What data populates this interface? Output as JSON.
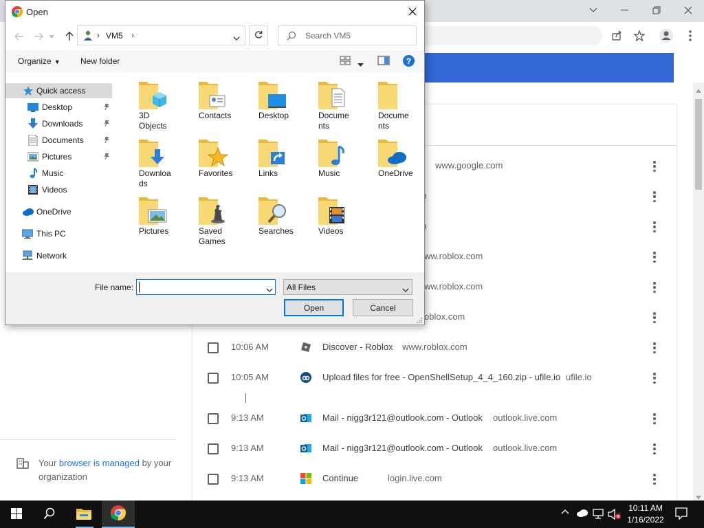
{
  "dialog": {
    "title": "Open",
    "address": {
      "location": "VM5"
    },
    "search_placeholder": "Search VM5",
    "toolbar": {
      "organize": "Organize",
      "new_folder": "New folder"
    },
    "nav": {
      "quick_access": "Quick access",
      "desktop": "Desktop",
      "downloads": "Downloads",
      "documents": "Documents",
      "pictures": "Pictures",
      "music": "Music",
      "videos": "Videos",
      "onedrive": "OneDrive",
      "this_pc": "This PC",
      "network": "Network"
    },
    "files": [
      {
        "l1": "3D",
        "l2": "Objects"
      },
      {
        "l1": "Contacts",
        "l2": ""
      },
      {
        "l1": "Desktop",
        "l2": ""
      },
      {
        "l1": "Docume",
        "l2": "nts"
      },
      {
        "l1": "Docume",
        "l2": "nts"
      },
      {
        "l1": "Downloa",
        "l2": "ds"
      },
      {
        "l1": "Favorites",
        "l2": ""
      },
      {
        "l1": "Links",
        "l2": ""
      },
      {
        "l1": "Music",
        "l2": ""
      },
      {
        "l1": "OneDrive",
        "l2": ""
      },
      {
        "l1": "Pictures",
        "l2": ""
      },
      {
        "l1": "Saved",
        "l2": "Games"
      },
      {
        "l1": "Searches",
        "l2": ""
      },
      {
        "l1": "Videos",
        "l2": ""
      }
    ],
    "file_name_label": "File name:",
    "file_name_value": "",
    "file_type": "All Files",
    "open_label": "Open",
    "cancel_label": "Cancel"
  },
  "history": {
    "rows": [
      {
        "time": "",
        "title": "",
        "domain": "www.google.com"
      },
      {
        "time": "",
        "title": "",
        "domain": "n"
      },
      {
        "time": "",
        "title": "",
        "domain": "n"
      },
      {
        "time": "",
        "title": "",
        "domain": "ww.roblox.com"
      },
      {
        "time": "",
        "title": "",
        "domain": "ww.roblox.com"
      },
      {
        "time": "",
        "title": "",
        "domain": "oblox.com"
      },
      {
        "time": "10:06 AM",
        "title": "Discover - Roblox",
        "domain": "www.roblox.com"
      },
      {
        "time": "10:05 AM",
        "title": "Upload files for free - OpenShellSetup_4_4_160.zip - ufile.io",
        "domain": "ufile.io"
      },
      {
        "time": "9:13 AM",
        "title": "Mail - nigg3r121@outlook.com - Outlook",
        "domain": "outlook.live.com"
      },
      {
        "time": "9:13 AM",
        "title": "Mail - nigg3r121@outlook.com - Outlook",
        "domain": "outlook.live.com"
      },
      {
        "time": "9:13 AM",
        "title": "Continue",
        "domain": "login.live.com"
      }
    ]
  },
  "managed": {
    "pre": "Your ",
    "link": "browser is managed",
    "post": " by your organization"
  },
  "taskbar": {
    "time": "10:11 AM",
    "date": "1/16/2022"
  },
  "colors": {
    "accent": "#0078d7",
    "chrome_blue": "#3367d6",
    "folder": "#f8d775"
  }
}
